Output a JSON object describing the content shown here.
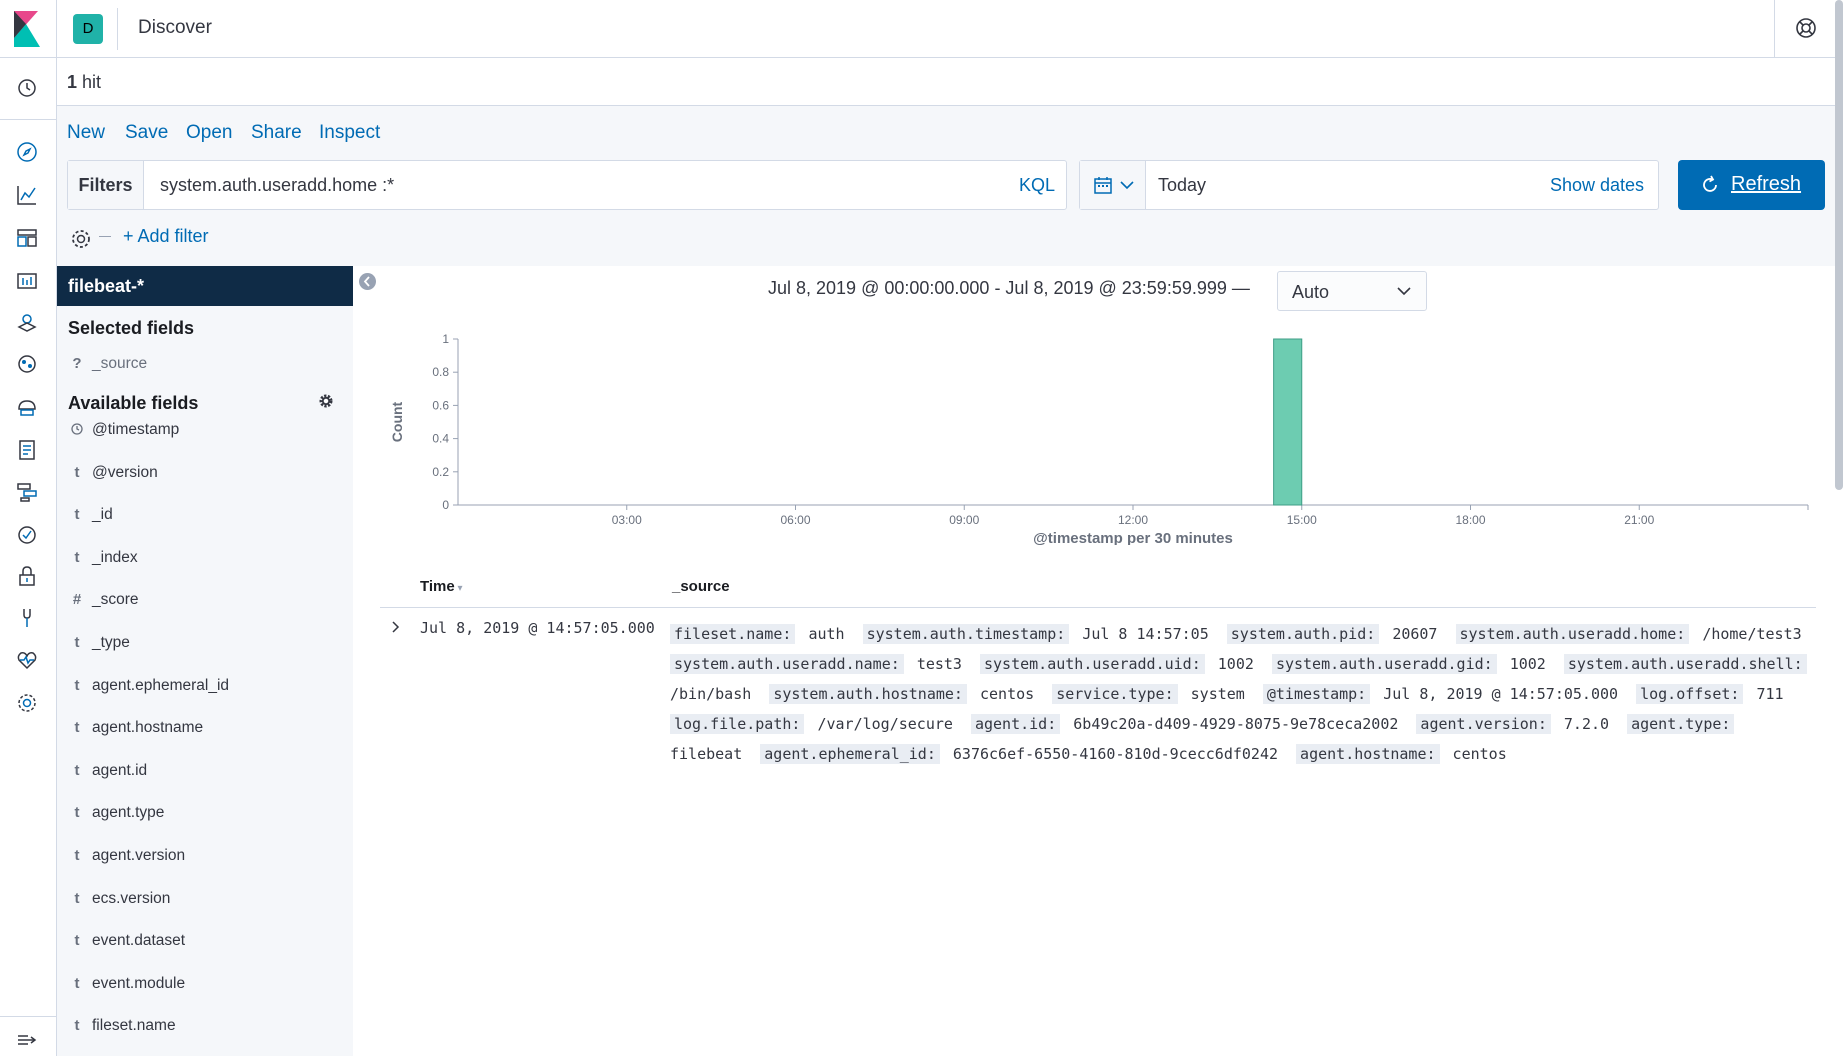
{
  "header": {
    "app_title": "Discover",
    "space_initial": "D"
  },
  "hits": {
    "count": "1",
    "label": "hit"
  },
  "top_nav": {
    "new": "New",
    "save": "Save",
    "open": "Open",
    "share": "Share",
    "inspect": "Inspect"
  },
  "query": {
    "filters_label": "Filters",
    "text": "system.auth.useradd.home :*",
    "language": "KQL"
  },
  "date_picker": {
    "value": "Today",
    "show_dates": "Show dates"
  },
  "refresh_label": "Refresh",
  "add_filter": "+ Add filter",
  "sidebar": {
    "index_pattern": "filebeat-*",
    "selected_title": "Selected fields",
    "selected_fields": [
      {
        "type": "?",
        "name": "_source"
      }
    ],
    "available_title": "Available fields",
    "available_fields": [
      {
        "type": "clock",
        "name": "@timestamp"
      },
      {
        "type": "t",
        "name": "@version"
      },
      {
        "type": "t",
        "name": "_id"
      },
      {
        "type": "t",
        "name": "_index"
      },
      {
        "type": "#",
        "name": "_score"
      },
      {
        "type": "t",
        "name": "_type"
      },
      {
        "type": "t",
        "name": "agent.ephemeral_id"
      },
      {
        "type": "t",
        "name": "agent.hostname"
      },
      {
        "type": "t",
        "name": "agent.id"
      },
      {
        "type": "t",
        "name": "agent.type"
      },
      {
        "type": "t",
        "name": "agent.version"
      },
      {
        "type": "t",
        "name": "ecs.version"
      },
      {
        "type": "t",
        "name": "event.dataset"
      },
      {
        "type": "t",
        "name": "event.module"
      },
      {
        "type": "t",
        "name": "fileset.name"
      }
    ]
  },
  "histogram": {
    "time_range": "Jul 8, 2019 @ 00:00:00.000 - Jul 8, 2019 @ 23:59:59.999 —",
    "interval": "Auto"
  },
  "chart_data": {
    "type": "bar",
    "xlabel": "@timestamp per 30 minutes",
    "ylabel": "Count",
    "x_ticks": [
      "03:00",
      "06:00",
      "09:00",
      "12:00",
      "15:00",
      "18:00",
      "21:00"
    ],
    "y_ticks": [
      "0",
      "0.2",
      "0.4",
      "0.6",
      "0.8",
      "1"
    ],
    "ylim": [
      0,
      1
    ],
    "xlim_hours": [
      0,
      24
    ],
    "bars": [
      {
        "start_hour": 14.5,
        "end_hour": 15.0,
        "value": 1
      }
    ],
    "bar_color": "#6dccb1"
  },
  "table": {
    "col_time": "Time",
    "col_source": "_source",
    "rows": [
      {
        "time": "Jul 8, 2019 @ 14:57:05.000",
        "fields": [
          {
            "k": "fileset.name:",
            "v": "auth"
          },
          {
            "k": "system.auth.timestamp:",
            "v": "Jul 8 14:57:05"
          },
          {
            "k": "system.auth.pid:",
            "v": "20607"
          },
          {
            "k": "system.auth.useradd.home:",
            "v": "/home/test3"
          },
          {
            "k": "system.auth.useradd.name:",
            "v": "test3"
          },
          {
            "k": "system.auth.useradd.uid:",
            "v": "1002"
          },
          {
            "k": "system.auth.useradd.gid:",
            "v": "1002"
          },
          {
            "k": "system.auth.useradd.shell:",
            "v": "/bin/bash"
          },
          {
            "k": "system.auth.hostname:",
            "v": "centos"
          },
          {
            "k": "service.type:",
            "v": "system"
          },
          {
            "k": "@timestamp:",
            "v": "Jul 8, 2019 @ 14:57:05.000"
          },
          {
            "k": "log.offset:",
            "v": "711"
          },
          {
            "k": "log.file.path:",
            "v": "/var/log/secure"
          },
          {
            "k": "agent.id:",
            "v": "6b49c20a-d409-4929-8075-9e78ceca2002"
          },
          {
            "k": "agent.version:",
            "v": "7.2.0"
          },
          {
            "k": "agent.type:",
            "v": "filebeat"
          },
          {
            "k": "agent.ephemeral_id:",
            "v": "6376c6ef-6550-4160-810d-9cecc6df0242"
          },
          {
            "k": "agent.hostname:",
            "v": "centos"
          }
        ]
      }
    ]
  },
  "left_nav_icons": [
    "recent-icon",
    "discover-icon",
    "visualize-icon",
    "dashboard-icon",
    "canvas-icon",
    "maps-icon",
    "ml-icon",
    "infrastructure-icon",
    "logs-icon",
    "apm-icon",
    "uptime-icon",
    "security-icon",
    "dev-tools-icon",
    "monitoring-icon",
    "management-icon",
    "collapse-nav-icon"
  ]
}
